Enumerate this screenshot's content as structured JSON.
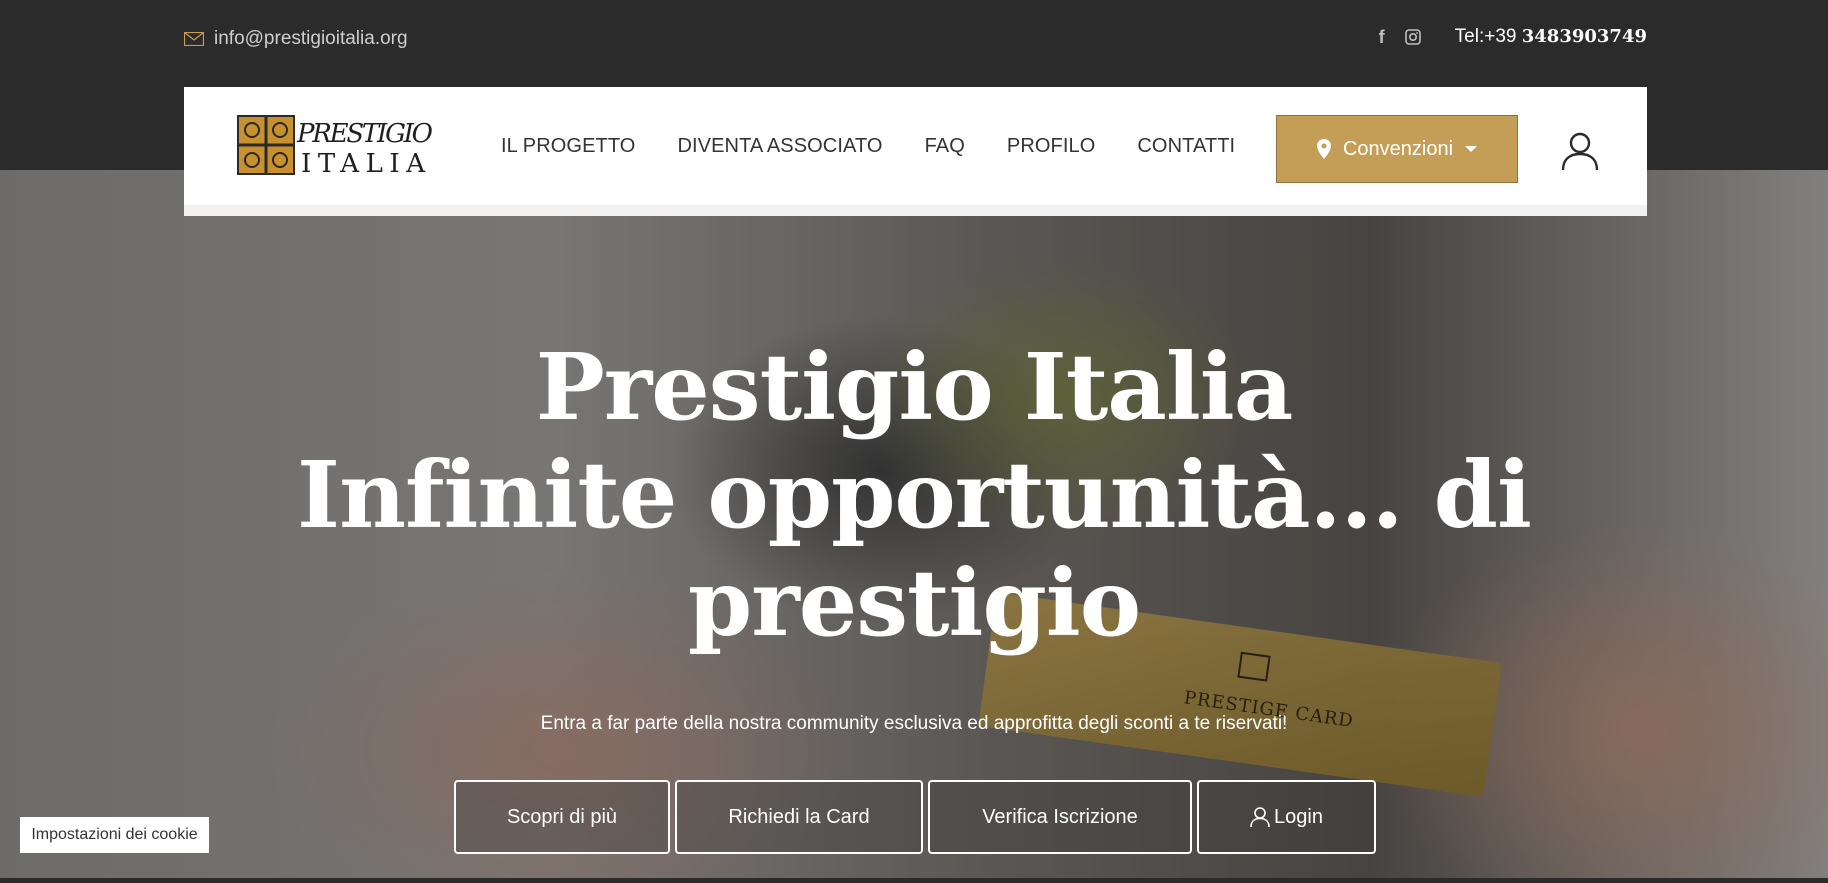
{
  "topbar": {
    "email": "info@prestigioitalia.org",
    "phone_prefix": "Tel:+39 ",
    "phone_number": "3483903749",
    "social": [
      {
        "icon": "facebook-icon",
        "glyph": "f"
      },
      {
        "icon": "instagram-icon",
        "glyph": "◘"
      }
    ]
  },
  "navbar": {
    "logo_text": "PRESTIGIO ITALIA",
    "items": [
      {
        "label": "IL PROGETTO"
      },
      {
        "label": "DIVENTA ASSOCIATO"
      },
      {
        "label": "FAQ"
      },
      {
        "label": "PROFILO"
      },
      {
        "label": "CONTATTI"
      }
    ],
    "convenzioni_label": "Convenzioni"
  },
  "hero": {
    "title_line1": "Prestigio Italia",
    "title_line2": "Infinite opportunità... di",
    "title_line3": "prestigio",
    "subtitle": "Entra a far parte della nostra community esclusiva ed approfitta degli sconti a te riservati!",
    "card_text": "PRESTIGE CARD",
    "buttons": [
      {
        "label": "Scopri di più"
      },
      {
        "label": "Richiedi la Card"
      },
      {
        "label": "Verifica Iscrizione"
      },
      {
        "label": "Login"
      }
    ]
  },
  "cookie": {
    "label": "Impostazioni dei cookie"
  },
  "colors": {
    "accent": "#c49e56",
    "topbar": "#2b2b2b",
    "nav_text": "#333333"
  }
}
